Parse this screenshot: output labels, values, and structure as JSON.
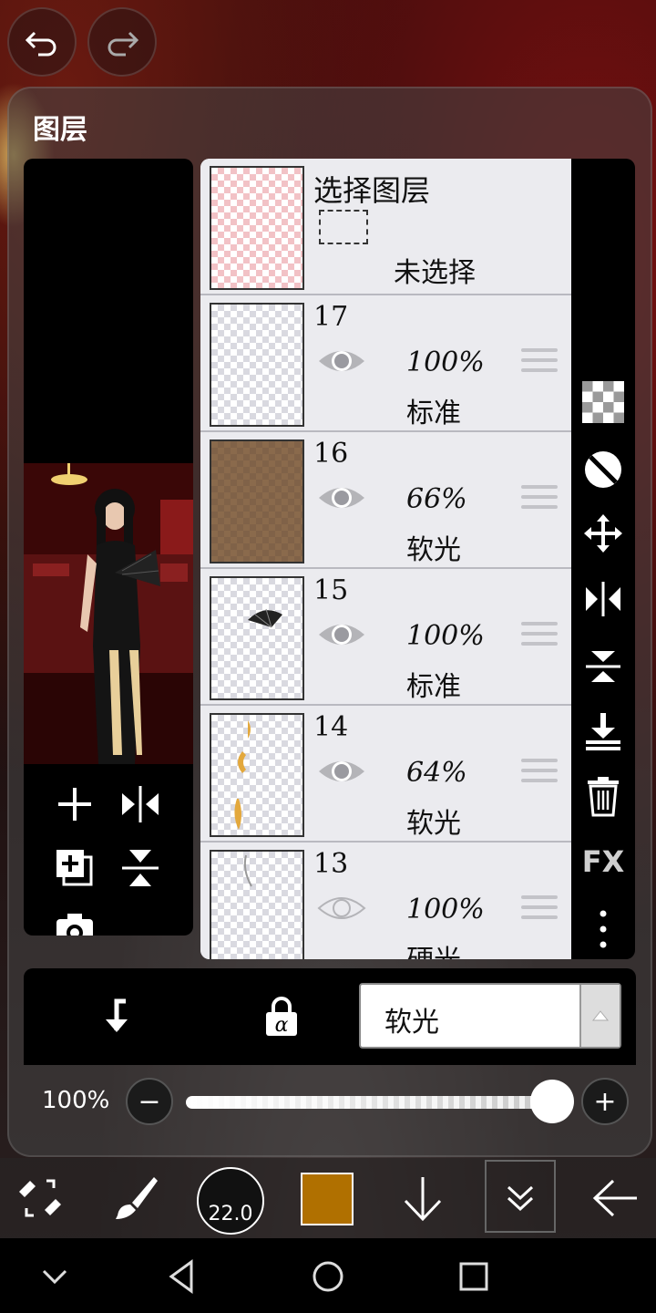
{
  "panel": {
    "title": "图层"
  },
  "selection_layer": {
    "title": "选择图层",
    "state": "未选择"
  },
  "layers": [
    {
      "number": "17",
      "opacity": "100%",
      "mode": "标准"
    },
    {
      "number": "16",
      "opacity": "66%",
      "mode": "软光"
    },
    {
      "number": "15",
      "opacity": "100%",
      "mode": "标准"
    },
    {
      "number": "14",
      "opacity": "64%",
      "mode": "软光"
    },
    {
      "number": "13",
      "opacity": "100%",
      "mode": "硬光"
    }
  ],
  "right_tools": {
    "fx_label": "FX"
  },
  "blend": {
    "current_mode": "软光"
  },
  "opacity": {
    "label": "100%",
    "value": 1.0
  },
  "toolbar": {
    "brush_size": "22.0",
    "color": "#b07000"
  }
}
